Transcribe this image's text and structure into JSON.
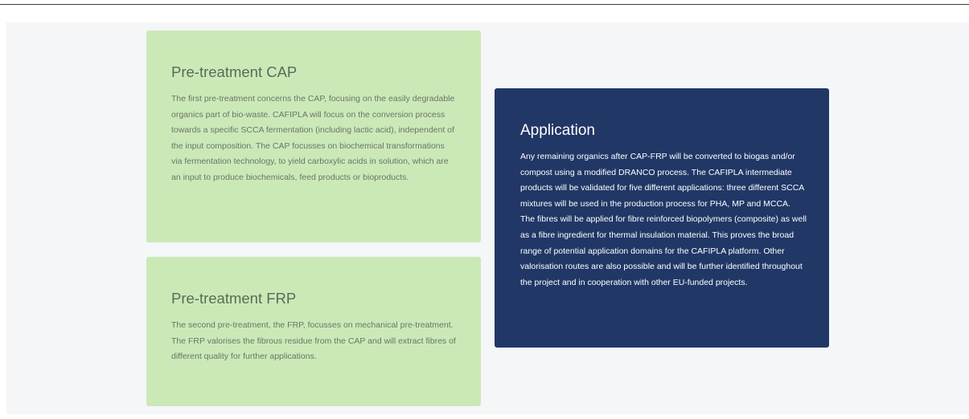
{
  "cards": {
    "cap": {
      "title": "Pre-treatment CAP",
      "body": "The first pre-treatment concerns the CAP, focusing on the easily degradable organics part of bio-waste. CAFIPLA will focus on the conversion process towards a specific SCCA fermentation (including lactic acid), independent of the input composition. The CAP focusses on biochemical transformations via fermentation technology, to yield carboxylic acids in solution, which are an input to produce biochemicals, feed products or bioproducts."
    },
    "frp": {
      "title": "Pre-treatment FRP",
      "body": "The second pre-treatment, the FRP, focusses on mechanical pre-treatment.  The FRP valorises the fibrous residue from the CAP and will extract fibres of different quality for further applications."
    },
    "application": {
      "title": "Application",
      "body": "Any remaining organics after CAP-FRP will be converted to biogas and/or compost using a modified DRANCO process. The CAFIPLA intermediate products will be validated for five different applications: three different SCCA mixtures will be used in the production process for PHA, MP and MCCA. The fibres will be applied for fibre reinforced biopolymers (composite) as well as a fibre ingredient for thermal insulation material. This proves the broad range of potential application domains for the CAFIPLA platform. Other valorisation routes are also possible and will be further identified throughout the project and in cooperation with other EU-funded projects."
    }
  },
  "colors": {
    "green_card": "#cbe9b7",
    "blue_card": "#213766",
    "section_bg": "#f5f6f8"
  }
}
